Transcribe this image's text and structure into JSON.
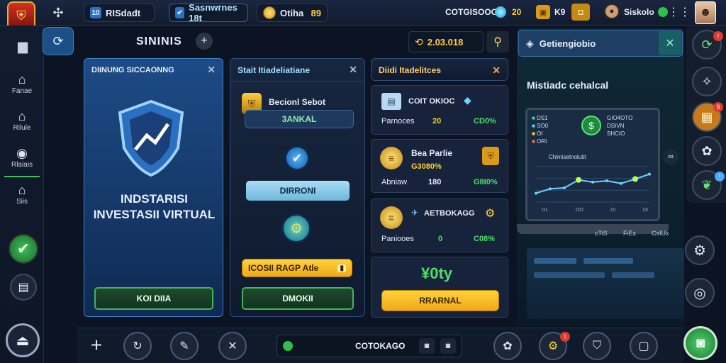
{
  "topbar": {
    "tab1_label": "RISdadt",
    "tab2_label": "Sasnwrnes 18t",
    "coin_label": "Otiha",
    "coin_value": "89",
    "player_name": "COTGISOOO",
    "stat1": "20",
    "stat2": "K9",
    "user_name": "Siskolo"
  },
  "header": {
    "title": "SININIS",
    "currency_value": "2.03.018"
  },
  "left_rail": {
    "items": [
      {
        "label": "Fanae"
      },
      {
        "label": "Rilule"
      },
      {
        "label": "Rlaiais"
      },
      {
        "label": "Siis"
      }
    ]
  },
  "panel_invest": {
    "header": "DIINUNG SICCAONNG",
    "title_line1": "INDSTARISI",
    "title_line2": "INVESTASII VIRTUAL",
    "button": "KOI DIIA"
  },
  "panel_middle": {
    "header": "Stait Itiadeliatiane",
    "card_title": "Becionl Sebot",
    "card_button": "3ANKAL",
    "button_mid": "DIRRONI",
    "button_yellow": "ICOSII RAGP Atle",
    "button_bottom": "DMOKII"
  },
  "panel_list": {
    "header": "Diidi Itadelitces",
    "rows": [
      {
        "title": "COIT OKIOC",
        "label": "Parnoces",
        "value": "20",
        "pct": "CD0%"
      },
      {
        "title": "Bea Parlie",
        "sub": "G3080%",
        "label": "Abniaw",
        "value": "180",
        "pct": "G8I0%"
      },
      {
        "title": "AETBOKAGG",
        "label": "Paniooes",
        "value": "0",
        "pct": "C08%"
      }
    ],
    "total": "¥0ty",
    "button": "RRARNAL"
  },
  "panel_right": {
    "header": "Getiengiobio",
    "title": "Mistiadc cehalcal",
    "legend": [
      "DS1",
      "SO0",
      "OI",
      "ORI"
    ],
    "info": [
      "GIO4OTO",
      "DSIVN",
      "SHCIO"
    ],
    "chart_label": "Chlmisetnolutit",
    "tick_labels": [
      "OL",
      "OO",
      "DI",
      "OI"
    ],
    "card_labels": [
      "cTiS",
      "FiEx",
      "CsIUx"
    ]
  },
  "bottom": {
    "search_label": "COTOKAGO"
  },
  "colors": {
    "accent_green": "#4ddf6a",
    "accent_yellow": "#ffcf3a",
    "accent_cyan": "#6fb7dc",
    "panel_border": "#2d4e78"
  },
  "chart_data": {
    "type": "line",
    "title": "",
    "xlabel": "",
    "ylabel": "",
    "x": [
      1,
      2,
      3,
      4,
      5,
      6,
      7,
      8,
      9
    ],
    "series": [
      {
        "values": [
          2,
          3,
          3.2,
          5,
          4.5,
          4.8,
          4.2,
          5.2,
          6.3
        ]
      }
    ],
    "ylim": [
      0,
      8
    ],
    "grid": true
  }
}
